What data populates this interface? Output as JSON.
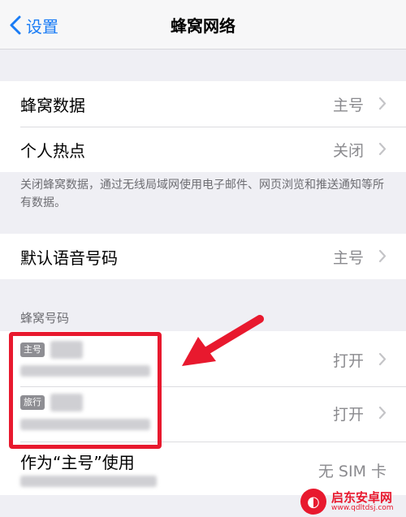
{
  "navbar": {
    "back_label": "设置",
    "title": "蜂窝网络"
  },
  "cellular": {
    "data_label": "蜂窝数据",
    "data_value": "主号",
    "hotspot_label": "个人热点",
    "hotspot_value": "关闭"
  },
  "footer_note": "关闭蜂窝数据，通过无线局域网使用电子邮件、网页浏览和推送通知等所有数据。",
  "voice": {
    "label": "默认语音号码",
    "value": "主号"
  },
  "sim_section": {
    "header": "蜂窝号码",
    "lines": [
      {
        "badge": "主号",
        "status": "打开"
      },
      {
        "badge": "旅行",
        "status": "打开"
      }
    ],
    "use_as_label": "作为“主号”使用",
    "use_as_value": "无 SIM 卡"
  },
  "watermark": {
    "text": "启东安卓网",
    "sub": "www.qdltdsj.com"
  },
  "colors": {
    "accent": "#1a7cf5",
    "highlight": "#e8192e",
    "background": "#efeff4"
  }
}
